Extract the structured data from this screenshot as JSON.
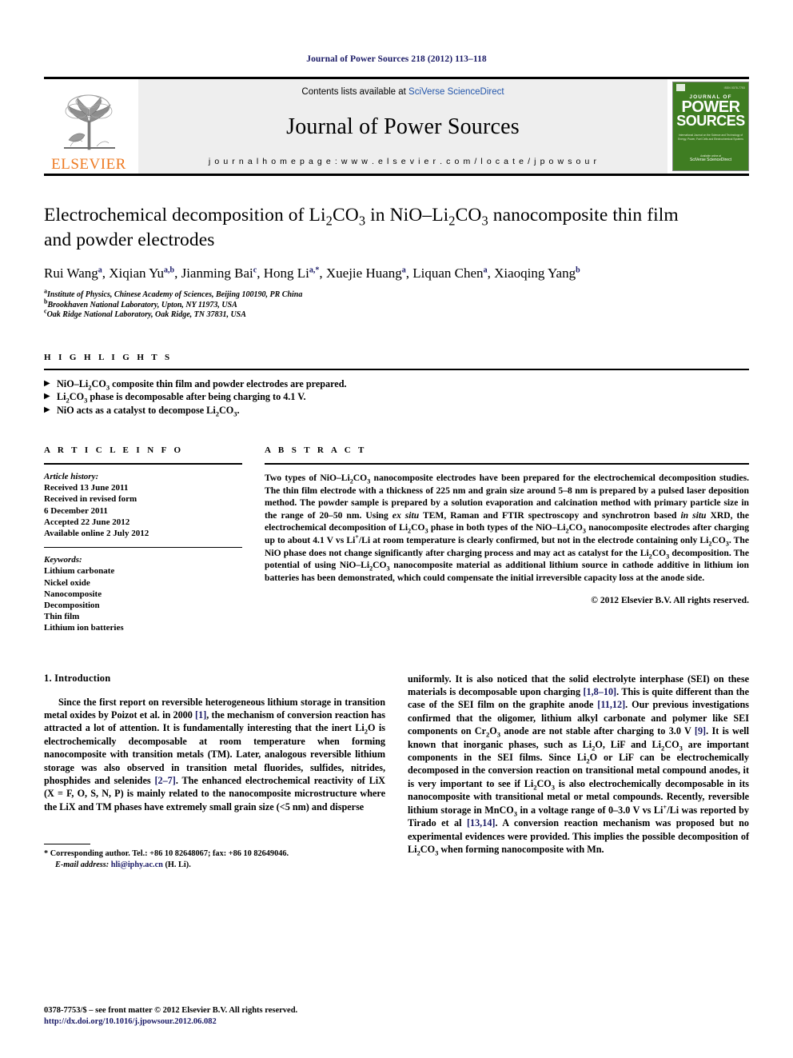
{
  "running_head": "Journal of Power Sources 218 (2012) 113–118",
  "masthead": {
    "publisher_name": "ELSEVIER",
    "contents_prefix": "Contents lists available at ",
    "contents_link": "SciVerse ScienceDirect",
    "journal_name": "Journal of Power Sources",
    "homepage": "j o u r n a l   h o m e p a g e :   w w w . e l s e v i e r . c o m / l o c a t e / j p o w s o u r",
    "cover": {
      "journal_of": "JOURNAL OF",
      "power": "POWER",
      "sources": "SOURCES",
      "subtitle": "International Journal on the Science and Technology of Energy, Power, Fuel Cells and Electrochemical Systems",
      "footer_small": "Available online at",
      "footer_bold": "SciVerse ScienceDirect"
    }
  },
  "article": {
    "title_line1": "Electrochemical decomposition of Li2CO3 in NiO–Li2CO3 nanocomposite thin film",
    "title_line2": "and powder electrodes",
    "authors": [
      {
        "name": "Rui Wang",
        "sup": "a"
      },
      {
        "name": "Xiqian Yu",
        "sup": "a,b"
      },
      {
        "name": "Jianming Bai",
        "sup": "c"
      },
      {
        "name": "Hong Li",
        "sup": "a,*"
      },
      {
        "name": "Xuejie Huang",
        "sup": "a"
      },
      {
        "name": "Liquan Chen",
        "sup": "a"
      },
      {
        "name": "Xiaoqing Yang",
        "sup": "b"
      }
    ],
    "affiliations": [
      {
        "sup": "a",
        "text": "Institute of Physics, Chinese Academy of Sciences, Beijing 100190, PR China"
      },
      {
        "sup": "b",
        "text": "Brookhaven National Laboratory, Upton, NY 11973, USA"
      },
      {
        "sup": "c",
        "text": "Oak Ridge National Laboratory, Oak Ridge, TN 37831, USA"
      }
    ]
  },
  "highlights": {
    "heading": "H I G H L I G H T S",
    "items": [
      "NiO–Li2CO3 composite thin film and powder electrodes are prepared.",
      "Li2CO3 phase is decomposable after being charging to 4.1 V.",
      "NiO acts as a catalyst to decompose Li2CO3."
    ],
    "bullet": "▶"
  },
  "article_info": {
    "heading": "A R T I C L E   I N F O",
    "history_label": "Article history:",
    "history": [
      "Received 13 June 2011",
      "Received in revised form",
      "6 December 2011",
      "Accepted 22 June 2012",
      "Available online 2 July 2012"
    ],
    "keywords_label": "Keywords:",
    "keywords": [
      "Lithium carbonate",
      "Nickel oxide",
      "Nanocomposite",
      "Decomposition",
      "Thin film",
      "Lithium ion batteries"
    ]
  },
  "abstract": {
    "heading": "A B S T R A C T",
    "paragraph_parts": [
      "Two types of NiO–Li2CO3 nanocomposite electrodes have been prepared for the electrochemical decomposition studies. The thin film electrode with a thickness of 225 nm and grain size around 5–8 nm is prepared by a pulsed laser deposition method. The powder sample is prepared by a solution evaporation and calcination method with primary particle size in the range of 20–50 nm. Using ",
      "ex situ",
      " TEM, Raman and FTIR spectroscopy and synchrotron based ",
      "in situ",
      " XRD, the electrochemical decomposition of Li2CO3 phase in both types of the NiO–Li2CO3 nanocomposite electrodes after charging up to about 4.1 V vs Li+/Li at room temperature is clearly confirmed, but not in the electrode containing only Li2CO3. The NiO phase does not change significantly after charging process and may act as catalyst for the Li2CO3 decomposition. The potential of using NiO–Li2CO3 nanocomposite material as additional lithium source in cathode additive in lithium ion batteries has been demonstrated, which could compensate the initial irreversible capacity loss at the anode side."
    ],
    "copyright": "© 2012 Elsevier B.V. All rights reserved."
  },
  "introduction": {
    "heading": "1.  Introduction",
    "left_paragraph": "Since the first report on reversible heterogeneous lithium storage in transition metal oxides by Poizot et al. in 2000 [1], the mechanism of conversion reaction has attracted a lot of attention. It is fundamentally interesting that the inert Li2O is electrochemically decomposable at room temperature when forming nanocomposite with transition metals (TM). Later, analogous reversible lithium storage was also observed in transition metal fluorides, sulfides, nitrides, phosphides and selenides [2–7]. The enhanced electrochemical reactivity of LiX (X = F, O, S, N, P) is mainly related to the nanocomposite microstructure where the LiX and TM phases have extremely small grain size (<5 nm) and disperse",
    "right_paragraph": "uniformly. It is also noticed that the solid electrolyte interphase (SEI) on these materials is decomposable upon charging [1,8–10]. This is quite different than the case of the SEI film on the graphite anode [11,12]. Our previous investigations confirmed that the oligomer, lithium alkyl carbonate and polymer like SEI components on Cr2O3 anode are not stable after charging to 3.0 V [9]. It is well known that inorganic phases, such as Li2O, LiF and Li2CO3 are important components in the SEI films. Since Li2O or LiF can be electrochemically decomposed in the conversion reaction on transitional metal compound anodes, it is very important to see if Li2CO3 is also electrochemically decomposable in its nanocomposite with transitional metal or metal compounds. Recently, reversible lithium storage in MnCO3 in a voltage range of 0–3.0 V vs Li+/Li was reported by Tirado et al [13,14]. A conversion reaction mechanism was proposed but no experimental evidences were provided. This implies the possible decomposition of Li2CO3 when forming nanocomposite with Mn."
  },
  "footnote": {
    "star": "*",
    "corresponding": "Corresponding author. Tel.: +86 10 82648067; fax: +86 10 82649046.",
    "email_label": "E-mail address:",
    "email": "hli@iphy.ac.cn",
    "email_suffix": "(H. Li)."
  },
  "page_footer": {
    "issn_line": "0378-7753/$ – see front matter © 2012 Elsevier B.V. All rights reserved.",
    "doi": "http://dx.doi.org/10.1016/j.jpowsour.2012.06.082"
  }
}
